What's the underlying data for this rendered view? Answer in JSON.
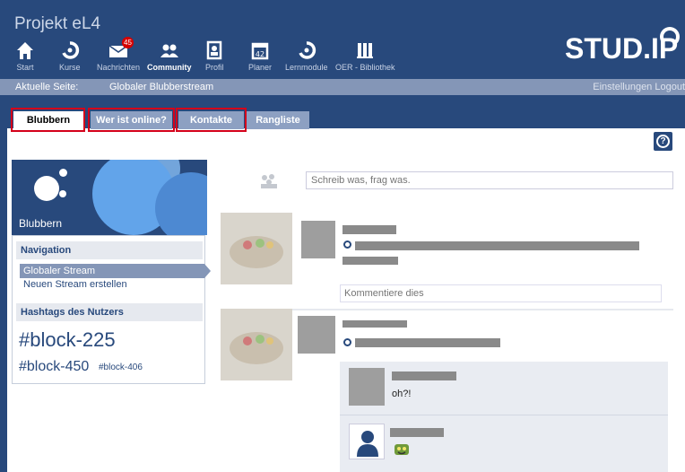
{
  "header": {
    "project_title": "Projekt eL4",
    "logo_text": "STUD.IP",
    "nav": [
      {
        "label": "Start",
        "icon": "home-icon"
      },
      {
        "label": "Kurse",
        "icon": "seminar-icon"
      },
      {
        "label": "Nachrichten",
        "icon": "mail-icon",
        "badge": "45"
      },
      {
        "label": "Community",
        "icon": "community-icon",
        "active": true
      },
      {
        "label": "Profil",
        "icon": "profile-icon"
      },
      {
        "label": "Planer",
        "icon": "calendar-icon"
      },
      {
        "label": "Lernmodule",
        "icon": "learnmodule-icon"
      },
      {
        "label": "OER - Bibliothek",
        "icon": "library-icon"
      }
    ]
  },
  "breadcrumb": {
    "label": "Aktuelle Seite:",
    "page": "Globaler Blubberstream",
    "right": "Einstellungen   Logout"
  },
  "tabs": [
    {
      "label": "Blubbern",
      "active": true,
      "highlighted": true
    },
    {
      "label": "Wer ist online?",
      "active": false,
      "highlighted": true
    },
    {
      "label": "Kontakte",
      "active": false,
      "highlighted": true
    },
    {
      "label": "Rangliste",
      "active": false,
      "highlighted": false
    }
  ],
  "help": {
    "icon": "help-icon",
    "glyph": "?"
  },
  "sidebar": {
    "title": "Blubbern",
    "navigation_heading": "Navigation",
    "nav_items": [
      "Globaler Stream",
      "Neuen Stream erstellen"
    ],
    "hashtags_heading": "Hashtags des Nutzers",
    "hashtags": [
      "#block-225",
      "#block-450",
      "#block-406"
    ]
  },
  "stream": {
    "compose_placeholder": "Schreib was, frag was.",
    "comment_placeholder": "Kommentiere dies",
    "reply_text": "oh?!"
  },
  "colors": {
    "brand_dark": "#28497c",
    "brand_light": "#8496b7",
    "highlight_red": "#d4001a"
  }
}
